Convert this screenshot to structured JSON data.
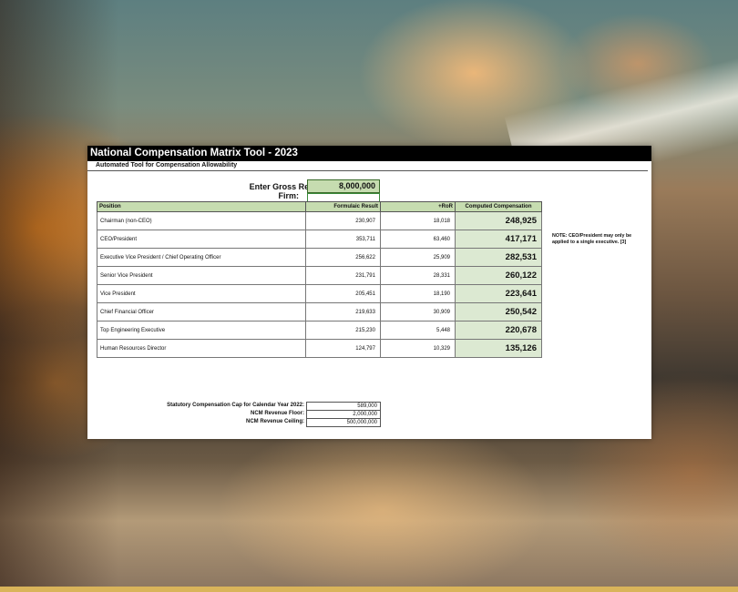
{
  "sheet": {
    "title": "National Compensation Matrix Tool - 2023",
    "subtitle": "Automated Tool for Compensation Allowability"
  },
  "revenue": {
    "label": "Enter Gross Revenues for Target Firm:",
    "value": "8,000,000"
  },
  "table": {
    "columns": [
      "Position",
      "Formulaic Result",
      "+RoR",
      "Computed Compensation"
    ],
    "rows": [
      {
        "position": "Chairman (non-CEO)",
        "formulaic": "230,907",
        "ror": "18,018",
        "computed": "248,925"
      },
      {
        "position": "CEO/President",
        "formulaic": "353,711",
        "ror": "63,460",
        "computed": "417,171"
      },
      {
        "position": "Executive Vice President / Chief Operating Officer",
        "formulaic": "256,622",
        "ror": "25,909",
        "computed": "282,531"
      },
      {
        "position": "Senior Vice President",
        "formulaic": "231,791",
        "ror": "28,331",
        "computed": "260,122"
      },
      {
        "position": "Vice President",
        "formulaic": "205,451",
        "ror": "18,190",
        "computed": "223,641"
      },
      {
        "position": "Chief Financial Officer",
        "formulaic": "219,633",
        "ror": "30,909",
        "computed": "250,542"
      },
      {
        "position": "Top Engineering Executive",
        "formulaic": "215,230",
        "ror": "5,448",
        "computed": "220,678"
      },
      {
        "position": "Human Resources Director",
        "formulaic": "124,797",
        "ror": "10,329",
        "computed": "135,126"
      }
    ]
  },
  "note": "NOTE: CEO/President may only be applied to a single executive. [3]",
  "footer": [
    {
      "label": "Statutory Compensation Cap for Calendar Year 2022:",
      "value": "589,000"
    },
    {
      "label": "NCM Revenue Floor:",
      "value": "2,000,000"
    },
    {
      "label": "NCM Revenue Ceiling:",
      "value": "500,000,000"
    }
  ],
  "colors": {
    "header_fill": "#c6dcb0",
    "computed_fill": "#dce9d2",
    "title_bar": "#000000"
  }
}
